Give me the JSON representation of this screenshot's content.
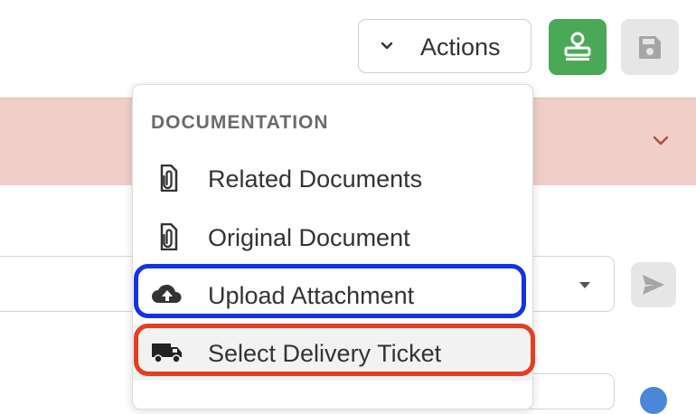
{
  "toolbar": {
    "actions_label": "Actions"
  },
  "menu": {
    "section_header": "DOCUMENTATION",
    "items": [
      {
        "label": "Related Documents",
        "icon": "paperclip-document-icon"
      },
      {
        "label": "Original Document",
        "icon": "paperclip-document-icon"
      },
      {
        "label": "Upload Attachment",
        "icon": "cloud-upload-icon"
      },
      {
        "label": "Select Delivery Ticket",
        "icon": "truck-icon"
      }
    ]
  },
  "colors": {
    "approve_button": "#4aa957",
    "alert_band": "#efcfc7",
    "highlight_blue": "#1432e6",
    "highlight_red": "#e63c20"
  }
}
